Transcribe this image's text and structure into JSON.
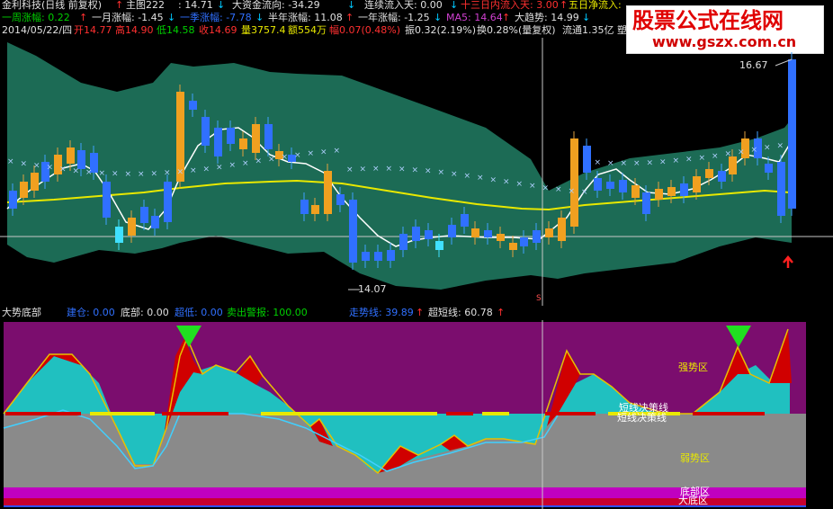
{
  "stock": {
    "name": "金利科技(日线 前复权)",
    "arrow_up": "↑",
    "arrow_down": "↓",
    "main_indicator": "主图222",
    "main_value": ": 14.71",
    "capital_flow": "大资金流向: -34.29",
    "continuous_inflow": "连续流入天: 0.00",
    "thirteen_day_inflow": "十三日内流入天: 3.00",
    "five_day_net": "五日净流入: "
  },
  "row2": {
    "week_change": "一周涨幅: 0.22",
    "month_change": "一月涨幅: -1.45",
    "quarter_change": "一季涨幅: -7.78",
    "half_year_change": "半年涨幅: 11.08",
    "year_change": "一年涨幅: -1.25",
    "ma5": "MA5: 14.64",
    "big_trend": "大趋势: 14.99"
  },
  "row3": {
    "date": "2014/05/22/四",
    "open": "开14.77",
    "high": "高14.90",
    "low": "低14.58",
    "close": "收14.69",
    "volume": "量3757.4",
    "amount": "额554万",
    "change": "幅0.07(0.48%)",
    "amplitude": "振0.32(2.19%)",
    "turnover": "换0.28%(量复权)",
    "float": "流通1.35亿 塑"
  },
  "price_labels": {
    "high_label": "16.67",
    "low_label": "14.07"
  },
  "sub": {
    "title": "大势底部",
    "build_pos": "建仓: 0.00",
    "bottom": "底部: 0.00",
    "super_low": "超低: 0.00",
    "sell_alert": "卖出警报: 100.00",
    "trend_line": "走势线: 39.89",
    "super_short": "超短线: 60.78"
  },
  "zones": {
    "strong": "强势区",
    "short_decision_1": "短线决策线",
    "short_decision_2": "短线决策线",
    "weak": "弱势区",
    "bottom": "底部区",
    "big_bottom": "大底区"
  },
  "brand": {
    "line1": "股票公式在线网",
    "line2": "www.gszx.com.cn"
  },
  "colors": {
    "band": "#1c6b55",
    "magenta_bg": "#7b0d6e",
    "gray_bg": "#8a8a8a",
    "cyan": "#20c0c0",
    "red": "#d00000",
    "yellow": "#e8e800",
    "blue_candle": "#3070ff",
    "orange_candle": "#f0a020"
  }
}
